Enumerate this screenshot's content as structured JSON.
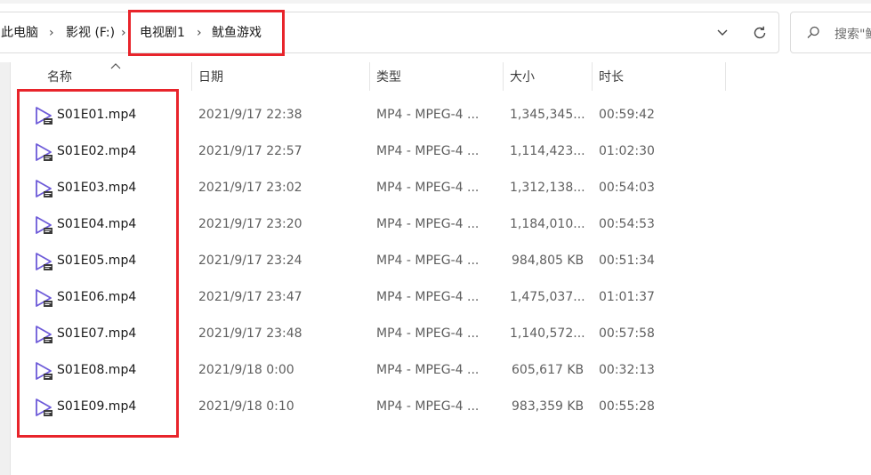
{
  "address": {
    "crumbs": [
      "此电脑",
      "影视 (F:)",
      "电视剧1",
      "鱿鱼游戏"
    ],
    "separator": "›"
  },
  "search": {
    "placeholder": "搜索\"鱿"
  },
  "columns": {
    "name": "名称",
    "date": "日期",
    "type": "类型",
    "size": "大小",
    "duration": "时长"
  },
  "files": [
    {
      "name": "S01E01.mp4",
      "date": "2021/9/17 22:38",
      "type": "MP4 - MPEG-4 ...",
      "size": "1,345,345...",
      "duration": "00:59:42"
    },
    {
      "name": "S01E02.mp4",
      "date": "2021/9/17 22:57",
      "type": "MP4 - MPEG-4 ...",
      "size": "1,114,423...",
      "duration": "01:02:30"
    },
    {
      "name": "S01E03.mp4",
      "date": "2021/9/17 23:02",
      "type": "MP4 - MPEG-4 ...",
      "size": "1,312,138...",
      "duration": "00:54:03"
    },
    {
      "name": "S01E04.mp4",
      "date": "2021/9/17 23:20",
      "type": "MP4 - MPEG-4 ...",
      "size": "1,184,010...",
      "duration": "00:54:53"
    },
    {
      "name": "S01E05.mp4",
      "date": "2021/9/17 23:24",
      "type": "MP4 - MPEG-4 ...",
      "size": "984,805 KB",
      "duration": "00:51:34"
    },
    {
      "name": "S01E06.mp4",
      "date": "2021/9/17 23:47",
      "type": "MP4 - MPEG-4 ...",
      "size": "1,475,037...",
      "duration": "01:01:37"
    },
    {
      "name": "S01E07.mp4",
      "date": "2021/9/17 23:48",
      "type": "MP4 - MPEG-4 ...",
      "size": "1,140,572...",
      "duration": "00:57:58"
    },
    {
      "name": "S01E08.mp4",
      "date": "2021/9/18 0:00",
      "type": "MP4 - MPEG-4 ...",
      "size": "605,617 KB",
      "duration": "00:32:13"
    },
    {
      "name": "S01E09.mp4",
      "date": "2021/9/18 0:10",
      "type": "MP4 - MPEG-4 ...",
      "size": "983,359 KB",
      "duration": "00:55:28"
    }
  ],
  "icons": {
    "file": "video-file-icon",
    "sort": "sort-up-icon",
    "dropdown": "chevron-down-icon",
    "refresh": "refresh-icon",
    "search": "search-icon"
  },
  "colors": {
    "highlight": "#e8242b",
    "file_icon": "#6e5bd9"
  }
}
